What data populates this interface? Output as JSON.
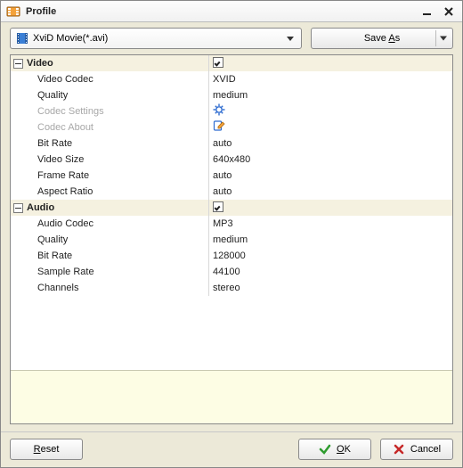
{
  "title": "Profile",
  "profile_select": "XviD Movie(*.avi)",
  "save_as": {
    "pre": "Save ",
    "mn": "A",
    "post": "s"
  },
  "sections": {
    "video": {
      "label": "Video",
      "checked": true,
      "rows": [
        {
          "label": "Video Codec",
          "value": "XVID"
        },
        {
          "label": "Quality",
          "value": "medium"
        },
        {
          "label": "Codec Settings",
          "value": "",
          "disabled": true,
          "icon": "gear"
        },
        {
          "label": "Codec About",
          "value": "",
          "disabled": true,
          "icon": "edit"
        },
        {
          "label": "Bit Rate",
          "value": "auto"
        },
        {
          "label": "Video Size",
          "value": "640x480"
        },
        {
          "label": "Frame Rate",
          "value": "auto"
        },
        {
          "label": "Aspect Ratio",
          "value": "auto"
        }
      ]
    },
    "audio": {
      "label": "Audio",
      "checked": true,
      "rows": [
        {
          "label": "Audio Codec",
          "value": "MP3"
        },
        {
          "label": "Quality",
          "value": "medium"
        },
        {
          "label": "Bit Rate",
          "value": "128000"
        },
        {
          "label": "Sample Rate",
          "value": "44100"
        },
        {
          "label": "Channels",
          "value": "stereo"
        }
      ]
    }
  },
  "buttons": {
    "reset": {
      "mn": "R",
      "post": "eset"
    },
    "ok": {
      "mn": "O",
      "post": "K"
    },
    "cancel": "Cancel"
  }
}
